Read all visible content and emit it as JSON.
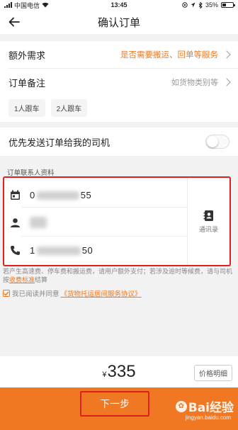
{
  "status_bar": {
    "carrier": "中国电信",
    "time": "13:45",
    "battery": "35%"
  },
  "header": {
    "title": "确认订单"
  },
  "extra_needs": {
    "label": "额外需求",
    "value": "是否需要搬运、回单等服务"
  },
  "order_note": {
    "label": "订单备注",
    "placeholder": "如货物类别等",
    "tags": [
      "1人跟车",
      "2人跟车"
    ]
  },
  "priority": {
    "label": "优先发送订单给我的司机",
    "enabled": false
  },
  "contact": {
    "section_title": "订单联系人资料",
    "date_prefix": "0",
    "date_suffix": "55",
    "phone_prefix": "1",
    "phone_suffix": "50",
    "address_book_label": "通讯录"
  },
  "note": {
    "text": "若产生高速费、停车费和搬运费，请用户额外支付；若涉及逾时等候费，请与司机按",
    "link": "收费标准",
    "tail": "结算"
  },
  "agreement": {
    "checked": true,
    "prefix": "我已阅读并同意",
    "link": "《货物托运居间服务协议》"
  },
  "price": {
    "currency": "¥",
    "amount": "335",
    "detail_label": "价格明细"
  },
  "next_button": {
    "label": "下一步"
  },
  "watermark": {
    "brand": "Bai经验",
    "url": "jingyan.baidu.com"
  },
  "colors": {
    "accent": "#f07822",
    "highlight_border": "#e02020"
  }
}
